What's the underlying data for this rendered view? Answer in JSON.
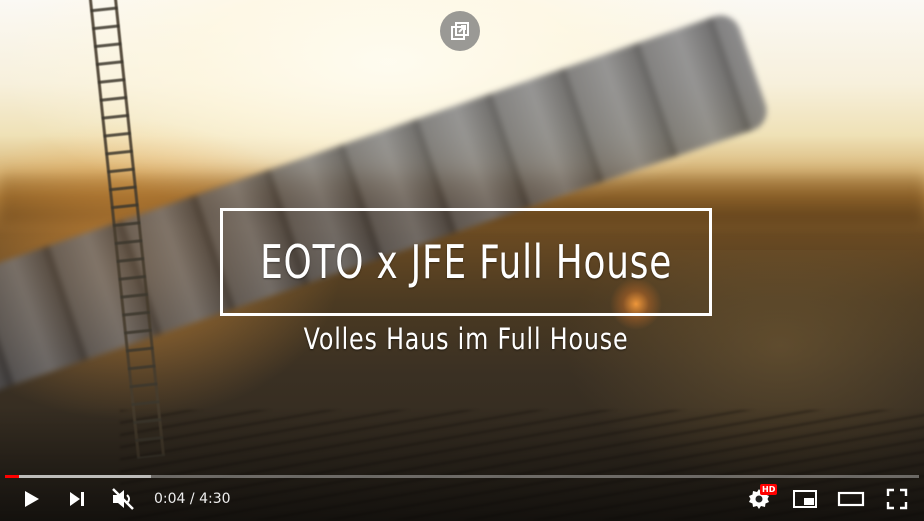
{
  "video": {
    "title_overlay": "EOTO x JFE Full House",
    "subtitle_overlay": "Volles Haus im Full House"
  },
  "controls": {
    "current_time": "0:04",
    "separator": "/",
    "duration": "4:30",
    "hd_label": "HD",
    "progress_played": 0.015,
    "progress_loaded": 0.16
  },
  "icons": [
    "popout-icon",
    "play-icon",
    "next-icon",
    "muted-volume-icon",
    "settings-icon",
    "miniplayer-icon",
    "theater-mode-icon",
    "fullscreen-icon"
  ],
  "colors": {
    "progress_played": "#ff0000",
    "hd_badge": "#ff0000"
  }
}
